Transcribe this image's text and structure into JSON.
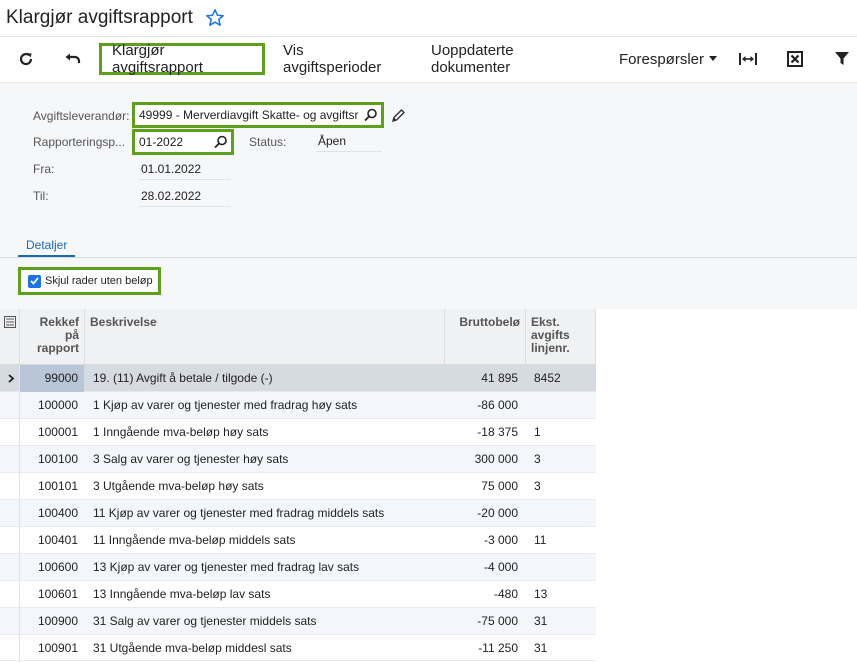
{
  "header": {
    "title": "Klargjør avgiftsrapport"
  },
  "toolbar": {
    "prepare_label": "Klargjør avgiftsrapport",
    "periods_label": "Vis avgiftsperioder",
    "unupdated_label": "Uoppdaterte dokumenter",
    "inquiries_label": "Forespørsler"
  },
  "form": {
    "vendor_label": "Avgiftsleverandør:",
    "vendor_value": "49999 - Merverdiavgift Skatte- og avgiftsr",
    "period_label": "Rapporteringsp...",
    "period_value": "01-2022",
    "status_label": "Status:",
    "status_value": "Åpen",
    "from_label": "Fra:",
    "from_value": "01.01.2022",
    "to_label": "Til:",
    "to_value": "28.02.2022"
  },
  "tabs": {
    "details": "Detaljer"
  },
  "filter": {
    "hide_zero_label": "Skjul rader uten beløp",
    "checked": true
  },
  "grid": {
    "columns": {
      "code": "Rekkef på rapport",
      "description": "Beskrivelse",
      "amount": "Bruttobelø",
      "ext_line": "Ekst. avgifts linjenr."
    },
    "rows": [
      {
        "code": "99000",
        "description": "19. (11) Avgift å betale / tilgode (-)",
        "amount": "41 895",
        "ext": "8452"
      },
      {
        "code": "100000",
        "description": "1 Kjøp av varer og tjenester med fradrag høy sats",
        "amount": "-86 000",
        "ext": ""
      },
      {
        "code": "100001",
        "description": "1 Inngående mva-beløp høy sats",
        "amount": "-18 375",
        "ext": "1"
      },
      {
        "code": "100100",
        "description": "3 Salg av varer og tjenester høy sats",
        "amount": "300 000",
        "ext": "3"
      },
      {
        "code": "100101",
        "description": "3 Utgående mva-beløp høy sats",
        "amount": "75 000",
        "ext": "3"
      },
      {
        "code": "100400",
        "description": "11 Kjøp av varer og tjenester med fradrag middels sats",
        "amount": "-20 000",
        "ext": ""
      },
      {
        "code": "100401",
        "description": "11 Inngående mva-beløp middels sats",
        "amount": "-3 000",
        "ext": "11"
      },
      {
        "code": "100600",
        "description": "13 Kjøp av varer og tjenester med fradrag lav sats",
        "amount": "-4 000",
        "ext": ""
      },
      {
        "code": "100601",
        "description": "13 Inngående mva-beløp lav sats",
        "amount": "-480",
        "ext": "13"
      },
      {
        "code": "100900",
        "description": "31 Salg av varer og tjenester middels sats",
        "amount": "-75 000",
        "ext": "31"
      },
      {
        "code": "100901",
        "description": "31 Utgående mva-beløp middesl sats",
        "amount": "-11 250",
        "ext": "31"
      }
    ]
  },
  "colors": {
    "highlight": "#5da01c",
    "accent": "#1a6bb5",
    "selected_row": "#d6dbe2"
  }
}
